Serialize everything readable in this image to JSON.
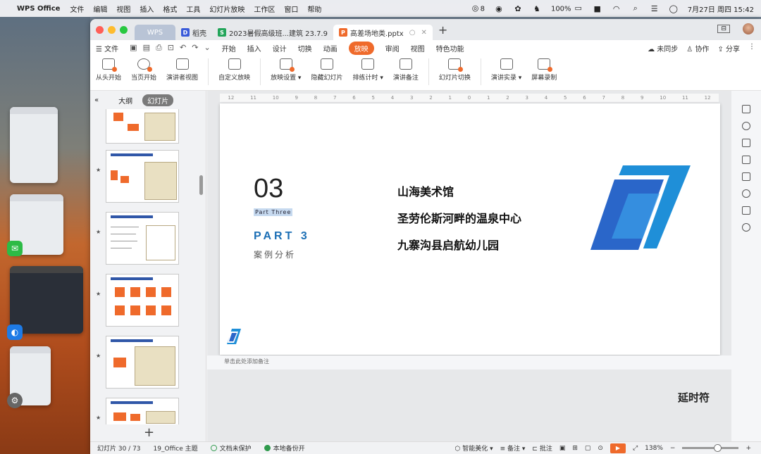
{
  "menubar": {
    "app_name": "WPS Office",
    "items": [
      "文件",
      "编辑",
      "视图",
      "插入",
      "格式",
      "工具",
      "幻灯片放映",
      "工作区",
      "窗口",
      "帮助"
    ],
    "wechat_count": "8",
    "battery": "100%",
    "date_time": "7月27日 周四  15:42"
  },
  "tabs": {
    "wps_label": "WPS",
    "tab1": "稻壳",
    "tab2": "2023暑假高级班...建筑 23.7.9",
    "tab3": "高差场地类.pptx"
  },
  "ribbon": {
    "file_label": "文件",
    "tabs": [
      "开始",
      "插入",
      "设计",
      "切换",
      "动画",
      "放映",
      "审阅",
      "视图",
      "特色功能"
    ],
    "active_tab": "放映",
    "right": [
      "未同步",
      "协作",
      "分享"
    ]
  },
  "toolbar": {
    "tools": [
      "从头开始",
      "当页开始",
      "演讲者视图",
      "自定义放映",
      "放映设置 ▾",
      "隐藏幻灯片",
      "排练计时 ▾",
      "演讲备注",
      "幻灯片切换",
      "演讲实录 ▾",
      "屏幕录制"
    ]
  },
  "sidebar": {
    "outline_label": "大纲",
    "slides_label": "幻灯片"
  },
  "slide": {
    "number": "03",
    "part_en": "Part Three",
    "part_label": "PART  3",
    "subtitle": "案例分析",
    "cases": [
      "山海美术馆",
      "圣劳伦斯河畔的温泉中心",
      "九寨沟县启航幼儿园"
    ]
  },
  "ruler_ticks": [
    "12",
    "11",
    "10",
    "9",
    "8",
    "7",
    "6",
    "5",
    "4",
    "3",
    "2",
    "1",
    "0",
    "1",
    "2",
    "3",
    "4",
    "5",
    "6",
    "7",
    "8",
    "9",
    "10",
    "11",
    "12"
  ],
  "notes_placeholder": "单击此处添加备注",
  "overlay_text": "延时符",
  "status": {
    "slide_count": "幻灯片 30 / 73",
    "theme": "19_Office 主题",
    "protect": "文档未保护",
    "backup": "本地备份开",
    "beautify": "智能美化 ▾",
    "notes": "备注 ▾",
    "comments": "批注",
    "zoom": "138%"
  },
  "colors": {
    "accent": "#ef6a2b",
    "slide_blue": "#1c6fb5"
  }
}
